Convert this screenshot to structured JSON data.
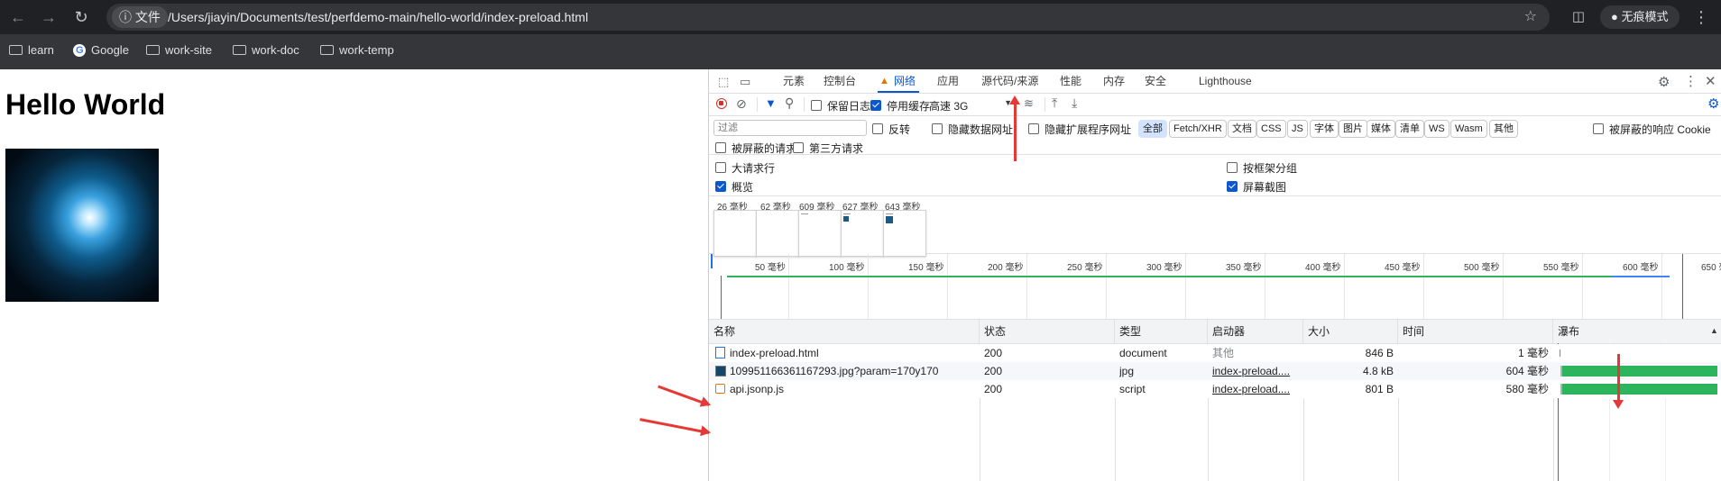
{
  "browser": {
    "file_chip": "文件",
    "url": "/Users/jiayin/Documents/test/perfdemo-main/hello-world/index-preload.html",
    "incognito_label": "无痕模式",
    "bookmarks": [
      "learn",
      "Google",
      "work-site",
      "work-doc",
      "work-temp"
    ]
  },
  "page": {
    "heading": "Hello World"
  },
  "devtools": {
    "tabs": [
      "元素",
      "控制台",
      "网络",
      "应用",
      "源代码/来源",
      "性能",
      "内存",
      "安全",
      "Lighthouse"
    ],
    "active_tab": "网络",
    "toolbar": {
      "preserve_log": "保留日志",
      "disable_cache": "停用缓存",
      "throttling": "高速 3G"
    },
    "filter": {
      "placeholder": "过滤",
      "invert": "反转",
      "hide_data_urls": "隐藏数据网址",
      "hide_extension_urls": "隐藏扩展程序网址",
      "types": [
        "全部",
        "Fetch/XHR",
        "文档",
        "CSS",
        "JS",
        "字体",
        "图片",
        "媒体",
        "清单",
        "WS",
        "Wasm",
        "其他"
      ],
      "blocked_cookies": "被屏蔽的响应 Cookie",
      "blocked_requests": "被屏蔽的请求",
      "third_party": "第三方请求"
    },
    "settings": {
      "large_rows": "大请求行",
      "group_by_frame": "按框架分组",
      "overview": "概览",
      "screenshots": "屏幕截图"
    },
    "screenshots": [
      "26 毫秒",
      "62 毫秒",
      "609 毫秒",
      "627 毫秒",
      "643 毫秒"
    ],
    "timeline_ticks": [
      "50 毫秒",
      "100 毫秒",
      "150 毫秒",
      "200 毫秒",
      "250 毫秒",
      "300 毫秒",
      "350 毫秒",
      "400 毫秒",
      "450 毫秒",
      "500 毫秒",
      "550 毫秒",
      "600 毫秒",
      "650 毫"
    ],
    "table": {
      "headers": [
        "名称",
        "状态",
        "类型",
        "启动器",
        "大小",
        "时间",
        "瀑布"
      ],
      "rows": [
        {
          "name": "index-preload.html",
          "status": "200",
          "type": "document",
          "initiator": "其他",
          "size": "846 B",
          "time": "1 毫秒",
          "icon": "document-icon"
        },
        {
          "name": "109951166361167293.jpg?param=170y170",
          "status": "200",
          "type": "jpg",
          "initiator": "index-preload....",
          "size": "4.8 kB",
          "time": "604 毫秒",
          "icon": "image-icon"
        },
        {
          "name": "api.jsonp.js",
          "status": "200",
          "type": "script",
          "initiator": "index-preload....",
          "size": "801 B",
          "time": "580 毫秒",
          "icon": "script-icon"
        }
      ]
    }
  },
  "colors": {
    "accent": "#0b57d0",
    "record": "#d93025",
    "waterfall_bar": "#2db55d",
    "annotation": "#e53935"
  }
}
